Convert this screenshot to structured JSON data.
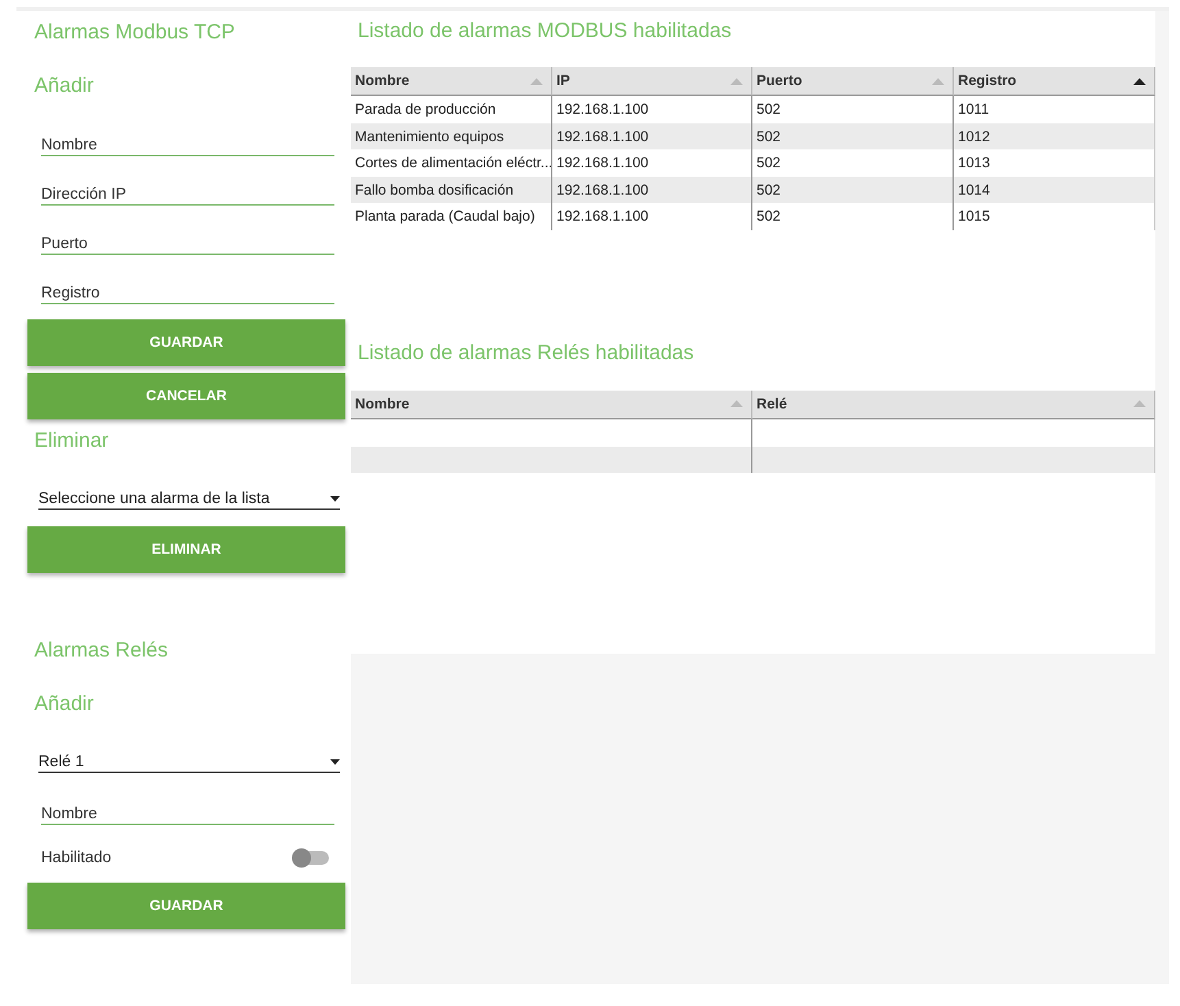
{
  "modbus_form": {
    "title": "Alarmas Modbus TCP",
    "add_heading": "Añadir",
    "fields": [
      {
        "placeholder": "Nombre"
      },
      {
        "placeholder": "Dirección IP"
      },
      {
        "placeholder": "Puerto"
      },
      {
        "placeholder": "Registro"
      }
    ],
    "buttons": [
      "GUARDAR",
      "CANCELAR"
    ],
    "delete_heading": "Eliminar",
    "delete_select": {
      "value": "Seleccione una alarma de la lista"
    },
    "delete_button": "ELIMINAR"
  },
  "relay_form": {
    "title": "Alarmas Relés",
    "add_heading": "Añadir",
    "relay_select": {
      "value": "Relé 1"
    },
    "name_field": {
      "placeholder": "Nombre"
    },
    "enabled": {
      "label": "Habilitado",
      "on": false
    },
    "button": "GUARDAR"
  },
  "modbus_table": {
    "title": "Listado de alarmas MODBUS habilitadas",
    "columns": [
      {
        "label": "Nombre",
        "sorted": false
      },
      {
        "label": "IP",
        "sorted": false
      },
      {
        "label": "Puerto",
        "sorted": false
      },
      {
        "label": "Registro",
        "sorted": true
      }
    ],
    "rows": [
      [
        "Parada de producción",
        "192.168.1.100",
        "502",
        "1011"
      ],
      [
        "Mantenimiento equipos",
        "192.168.1.100",
        "502",
        "1012"
      ],
      [
        "Cortes de alimentación eléctr...",
        "192.168.1.100",
        "502",
        "1013"
      ],
      [
        "Fallo bomba dosificación",
        "192.168.1.100",
        "502",
        "1014"
      ],
      [
        "Planta parada (Caudal bajo)",
        "192.168.1.100",
        "502",
        "1015"
      ]
    ]
  },
  "relay_table": {
    "title": "Listado de alarmas Relés habilitadas",
    "columns": [
      {
        "label": "Nombre",
        "sorted": false
      },
      {
        "label": "Relé",
        "sorted": false
      }
    ]
  }
}
